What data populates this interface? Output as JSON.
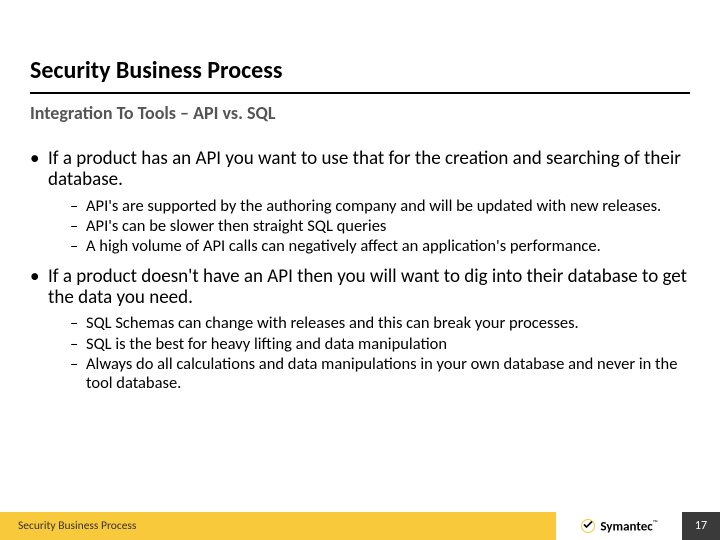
{
  "title": "Security Business Process",
  "subtitle": "Integration To Tools – API vs. SQL",
  "bullets": [
    {
      "text": "If a product has an API you want to use that for the creation and searching of their database.",
      "sub": [
        "API's are supported by the authoring company and will be updated with new releases.",
        "API's can be slower then straight SQL queries",
        "A high volume of API calls can negatively affect an application's performance."
      ]
    },
    {
      "text": "If a product doesn't have an API then you will want to dig into their database to get the data you need.",
      "sub": [
        "SQL Schemas can change with releases and this can break your processes.",
        "SQL is the best for heavy lifting and data manipulation",
        "Always do all calculations and data manipulations in your own database and never in the tool database."
      ]
    }
  ],
  "footer": {
    "label": "Security Business Process",
    "brand": "Symantec",
    "tm": "™",
    "page": "17"
  },
  "glyph": {
    "dot": "•",
    "dash": "–"
  }
}
